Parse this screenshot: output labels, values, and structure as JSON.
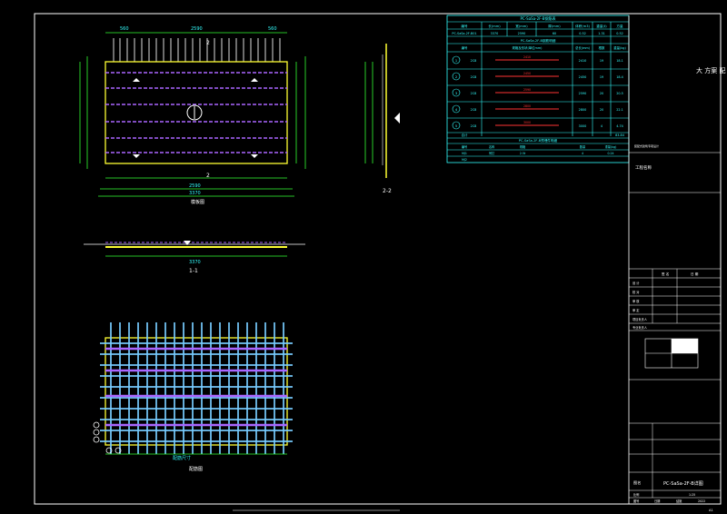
{
  "drawing": {
    "plan_label": "模板图",
    "section_1_label": "1-1",
    "section_2_label": "2-2",
    "rebar_plan_label": "配筋图",
    "dims_top": [
      "560",
      "2590",
      "560"
    ],
    "dim_total": "3370",
    "dim_bottom_inner": "2590",
    "section_dim": "3370",
    "rebar_dim": "配筋尺寸"
  },
  "rebar_table": {
    "title": "PC-SaSa-2F-B钢筋表",
    "headers": [
      "编号",
      "长(mm)",
      "宽(mm)",
      "厚(mm)",
      "体积(m3)",
      "重量(t)",
      "方量"
    ],
    "summary_row": [
      "PC-SaSa-2F-B01",
      "3370",
      "2590",
      "60",
      "0.52",
      "1.31",
      "0.52"
    ],
    "sub_title": "PC-SaSa-2F-B钢筋明细",
    "sub_headers": [
      "编号",
      "规格及形状(单位mm)",
      "总长(mm)",
      "根数",
      "重量(kg)"
    ],
    "rows": [
      {
        "id": "1",
        "spec": "2C8",
        "shape": "2410",
        "len": "2410",
        "count": "19",
        "weight": "18.1"
      },
      {
        "id": "2",
        "spec": "2C8",
        "shape": "2450",
        "len": "2450",
        "count": "19",
        "weight": "18.4"
      },
      {
        "id": "3",
        "spec": "2C8",
        "shape": "2590",
        "len": "2590",
        "count": "20",
        "weight": "20.5"
      },
      {
        "id": "4",
        "spec": "2C8",
        "shape": "2800",
        "len": "2800",
        "count": "20",
        "weight": "22.1"
      },
      {
        "id": "5",
        "spec": "2C8",
        "shape": "3000",
        "len": "3000",
        "count": "4",
        "weight": "4.74"
      }
    ],
    "total_label": "合计",
    "total_value": "83.84",
    "embed_title": "PC-SaSa-2F-B预埋件明细",
    "embed_headers": [
      "编号",
      "名称",
      "规格",
      "数量",
      "重量(kg)"
    ],
    "embed_rows": [
      [
        "MJ1",
        "吊钉",
        "2.5t",
        "4",
        "0.24"
      ],
      [
        "MJ2",
        "",
        "",
        "",
        ""
      ]
    ]
  },
  "title_block": {
    "company": "大 方案 配",
    "stamp_label": "装配式建筑专项设计",
    "project_label": "工程名称",
    "row_labels": [
      "设 计",
      "校 对",
      "审 核",
      "审 定",
      "项目负责人",
      "专业负责人"
    ],
    "col_labels": [
      "签 名",
      "日 期"
    ],
    "sheet_title_label": "图名",
    "sheet_name": "PC-SaSa-2F-B详图",
    "scale_label": "比例",
    "scale": "1:25",
    "date_label": "日期",
    "date": "2022",
    "drawing_no_label": "图号",
    "drawing_no": "结施",
    "corner_mark": "A1"
  }
}
